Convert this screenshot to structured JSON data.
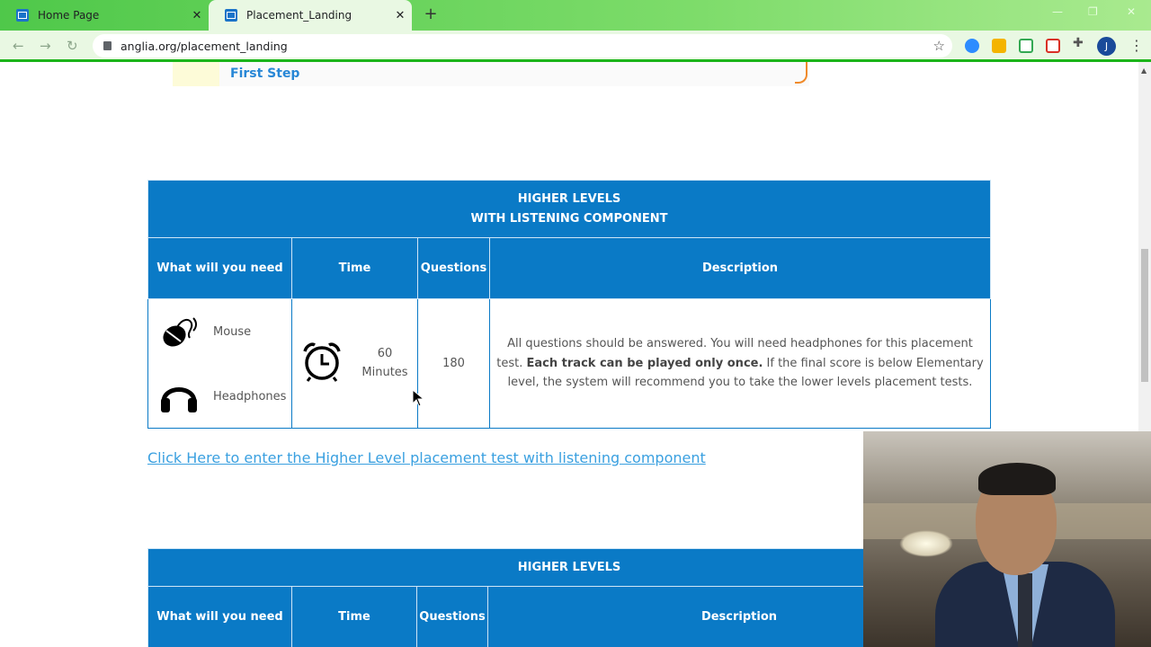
{
  "browser": {
    "tabs": [
      {
        "title": "Home Page",
        "close": "✕"
      },
      {
        "title": "Placement_Landing",
        "close": "✕"
      }
    ],
    "new_tab": "+",
    "url": "anglia.org/placement_landing",
    "profile_initial": "J"
  },
  "page": {
    "first_step_label": "First Step",
    "table1": {
      "title_line1": "HIGHER LEVELS",
      "title_line2": "WITH LISTENING COMPONENT",
      "headers": [
        "What will you need",
        "Time",
        "Questions",
        "Description"
      ],
      "needs": [
        "Mouse",
        "Headphones"
      ],
      "time_value": "60",
      "time_unit": "Minutes",
      "questions": "180",
      "description_part1": "All questions should be answered. You will need headphones for this placement test. ",
      "description_bold": "Each track can be played only once.",
      "description_part2": " If the final score is below Elementary level, the system will recommend you to take the lower levels placement tests."
    },
    "link_text": "Click Here to enter the Higher Level placement test with listening component",
    "table2": {
      "title": "HIGHER LEVELS",
      "headers": [
        "What will you need",
        "Time",
        "Questions",
        "Description"
      ]
    }
  },
  "colors": {
    "table_header": "#0a7ac6",
    "link": "#3aa0e0",
    "tab_bar": "#4fc84a"
  }
}
